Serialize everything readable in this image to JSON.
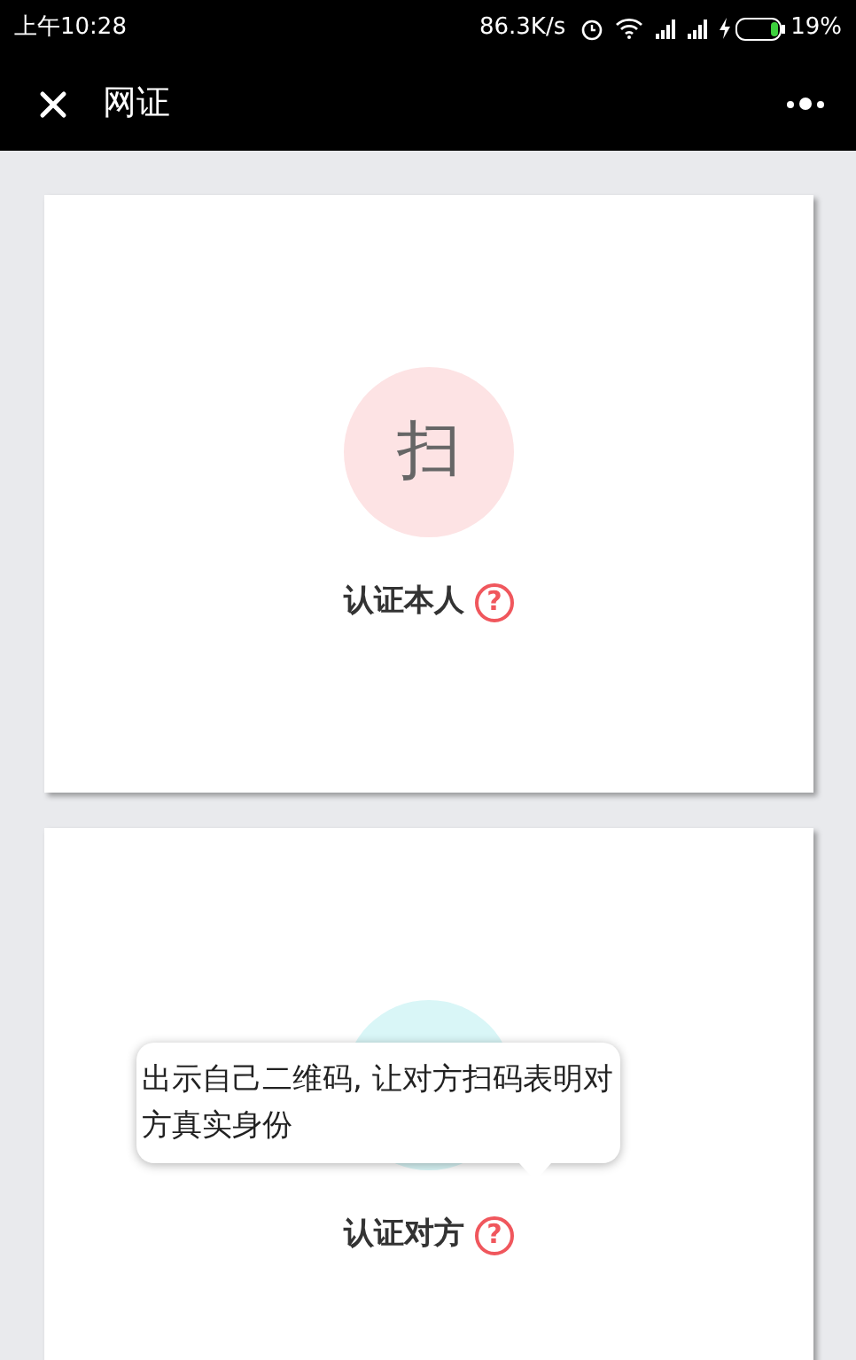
{
  "status_bar": {
    "time": "上午10:28",
    "speed": "86.3K/s",
    "battery": "19%"
  },
  "nav": {
    "title": "网证"
  },
  "cards": [
    {
      "circle_text": "扫",
      "color": "#fde3e4",
      "label": "认证本人",
      "help": "?"
    },
    {
      "color": "#d9f6f7",
      "label": "认证对方",
      "help": "?",
      "tooltip": "出示自己二维码, 让对方扫码表明对方真实身份"
    }
  ]
}
